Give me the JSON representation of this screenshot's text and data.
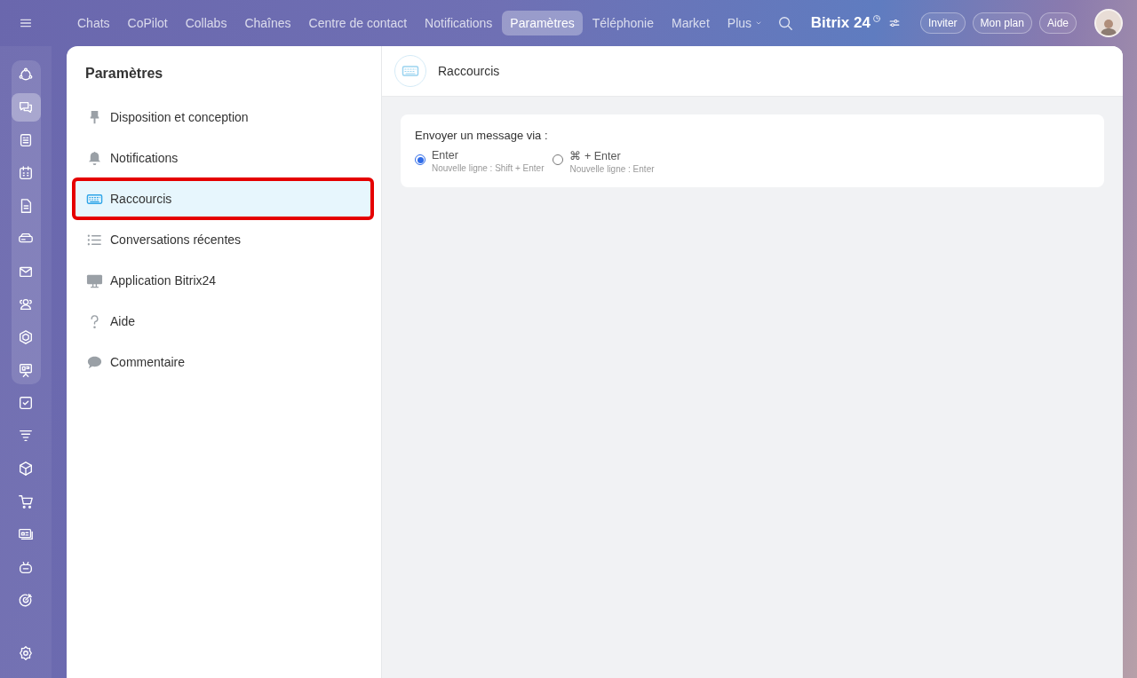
{
  "top_nav": {
    "tabs": [
      {
        "label": "Chats",
        "selected": false
      },
      {
        "label": "CoPilot",
        "selected": false
      },
      {
        "label": "Collabs",
        "selected": false
      },
      {
        "label": "Chaînes",
        "selected": false
      },
      {
        "label": "Centre de contact",
        "selected": false
      },
      {
        "label": "Notifications",
        "selected": false
      },
      {
        "label": "Paramètres",
        "selected": true
      },
      {
        "label": "Téléphonie",
        "selected": false
      },
      {
        "label": "Market",
        "selected": false
      }
    ],
    "more": "Plus",
    "logo": "Bitrix 24",
    "buttons": [
      "Inviter",
      "Mon plan",
      "Aide"
    ]
  },
  "rail": {
    "items": [
      {
        "selected": false
      },
      {
        "selected": true
      },
      {
        "selected": false
      },
      {
        "selected": false
      },
      {
        "selected": false
      },
      {
        "selected": false
      },
      {
        "selected": false
      },
      {
        "selected": false
      },
      {
        "selected": false
      },
      {
        "selected": false
      },
      {
        "selected": false
      },
      {
        "selected": false
      },
      {
        "selected": false
      },
      {
        "selected": false
      },
      {
        "selected": false
      },
      {
        "selected": false
      },
      {
        "selected": false
      }
    ]
  },
  "sidebar": {
    "title": "Paramètres",
    "items": [
      {
        "label": "Disposition et conception",
        "selected": false,
        "highlighted": false
      },
      {
        "label": "Notifications",
        "selected": false,
        "highlighted": false
      },
      {
        "label": "Raccourcis",
        "selected": true,
        "highlighted": true
      },
      {
        "label": "Conversations récentes",
        "selected": false,
        "highlighted": false
      },
      {
        "label": "Application Bitrix24",
        "selected": false,
        "highlighted": false
      },
      {
        "label": "Aide",
        "selected": false,
        "highlighted": false
      },
      {
        "label": "Commentaire",
        "selected": false,
        "highlighted": false
      }
    ]
  },
  "content": {
    "title": "Raccourcis",
    "card": {
      "heading": "Envoyer un message via :",
      "options": [
        {
          "label": "Enter",
          "hint": "Nouvelle ligne : Shift + Enter",
          "selected": true
        },
        {
          "label": "⌘ + Enter",
          "hint": "Nouvelle ligne : Enter",
          "selected": false
        }
      ]
    }
  }
}
